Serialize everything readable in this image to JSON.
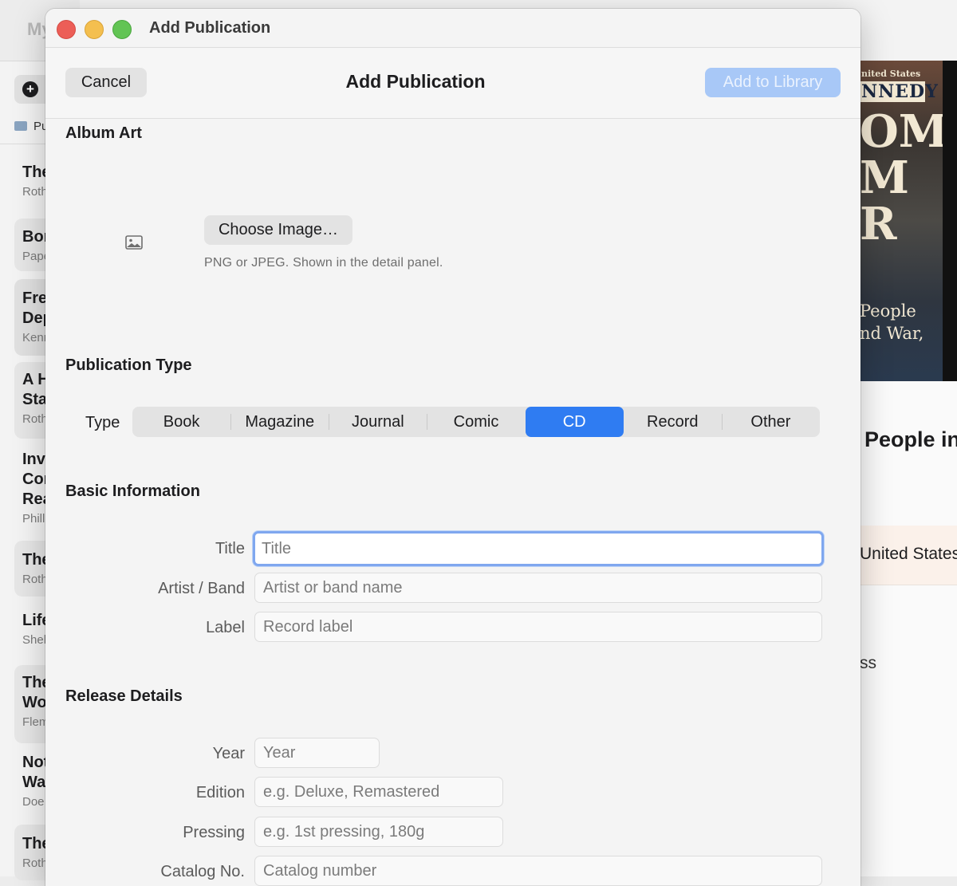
{
  "background_app": {
    "title_partial": "My",
    "folder_label": "Pu",
    "list_items": [
      {
        "title": "The",
        "subtitle": "Roth"
      },
      {
        "title": "Bor",
        "subtitle": "Pape"
      },
      {
        "title": "Fre\nDep",
        "subtitle": "Kenn"
      },
      {
        "title": "A H\nSta",
        "subtitle": "Roth"
      },
      {
        "title": "Inv\nCor\nRea",
        "subtitle": "Phill"
      },
      {
        "title": "The",
        "subtitle": "Roth"
      },
      {
        "title": "Life",
        "subtitle": "Shel"
      },
      {
        "title": "The\nWo",
        "subtitle": "Flem"
      },
      {
        "title": "Not\nWa",
        "subtitle": "Doe"
      },
      {
        "title": "The",
        "subtitle": "Roth"
      }
    ],
    "detail": {
      "cover_text_top": "nited States",
      "cover_text_name": "NNEDY",
      "cover_text_big": "OM\nM\nR",
      "cover_text_bottom": "People\nnd War,",
      "title_partial": "People in",
      "chip_text": "United States",
      "trailing_text": "ss"
    }
  },
  "window": {
    "title": "Add Publication"
  },
  "header": {
    "cancel_label": "Cancel",
    "title": "Add Publication",
    "add_label": "Add to Library"
  },
  "album_art": {
    "section_title": "Album Art",
    "choose_label": "Choose Image…",
    "hint": "PNG or JPEG. Shown in the detail panel."
  },
  "publication_type": {
    "section_title": "Publication Type",
    "label": "Type",
    "options": [
      "Book",
      "Magazine",
      "Journal",
      "Comic",
      "CD",
      "Record",
      "Other"
    ],
    "selected": "CD"
  },
  "basic_info": {
    "section_title": "Basic Information",
    "title_label": "Title",
    "title_placeholder": "Title",
    "artist_label": "Artist / Band",
    "artist_placeholder": "Artist or band name",
    "label_label": "Label",
    "label_placeholder": "Record label"
  },
  "release_details": {
    "section_title": "Release Details",
    "year_label": "Year",
    "year_placeholder": "Year",
    "edition_label": "Edition",
    "edition_placeholder": "e.g. Deluxe, Remastered",
    "pressing_label": "Pressing",
    "pressing_placeholder": "e.g. 1st pressing, 180g",
    "catalog_label": "Catalog No.",
    "catalog_placeholder": "Catalog number"
  },
  "colors": {
    "accent": "#2f7cf2",
    "primary_disabled": "#a8c8f7",
    "close": "#ec5e57",
    "minimize": "#f4bf4f",
    "maximize": "#62c454"
  }
}
